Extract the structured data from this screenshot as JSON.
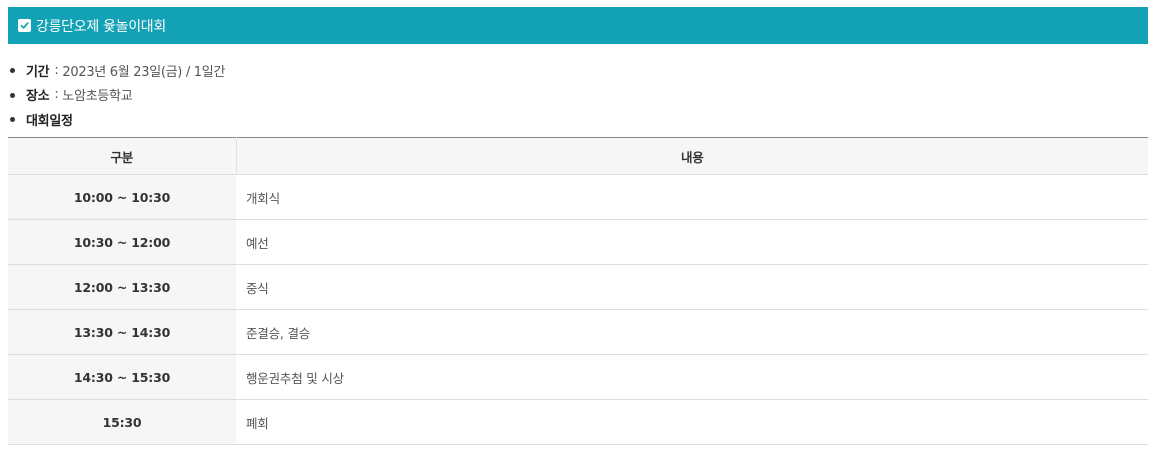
{
  "header": {
    "title": "강릉단오제 윷놀이대회",
    "icon": "checkbox-checked-icon",
    "background_color": "#13a1b6"
  },
  "info": [
    {
      "label": "기간",
      "separator": ":",
      "value": "2023년 6월 23일(금) / 1일간"
    },
    {
      "label": "장소",
      "separator": ":",
      "value": "노암초등학교"
    },
    {
      "label": "대회일정",
      "separator": "",
      "value": ""
    }
  ],
  "schedule": {
    "columns": [
      "구분",
      "내용"
    ],
    "rows": [
      {
        "time": "10:00 ~ 10:30",
        "content": "개회식"
      },
      {
        "time": "10:30 ~ 12:00",
        "content": "예선"
      },
      {
        "time": "12:00 ~ 13:30",
        "content": "중식"
      },
      {
        "time": "13:30 ~ 14:30",
        "content": "준결승, 결승"
      },
      {
        "time": "14:30 ~ 15:30",
        "content": "행운권추첨 및 시상"
      },
      {
        "time": "15:30",
        "content": "폐회"
      }
    ]
  }
}
